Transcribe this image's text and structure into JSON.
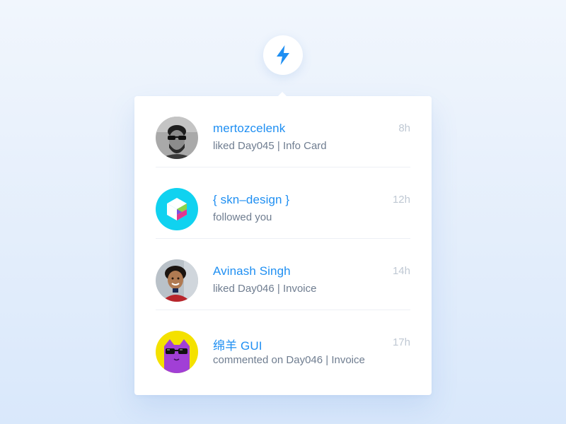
{
  "trigger": {
    "icon": "lightning-bolt-icon",
    "accent_color": "#1f8ff2"
  },
  "notifications": [
    {
      "name": "mertozcelenk",
      "action": "liked Day045 | Info Card",
      "time": "8h",
      "avatar": "bearded-man-sunglasses-avatar"
    },
    {
      "name": "{ skn–design }",
      "action": "followed you",
      "time": "12h",
      "avatar": "cube-logo-avatar"
    },
    {
      "name": "Avinash Singh",
      "action": "liked Day046 | Invoice",
      "time": "14h",
      "avatar": "smiling-man-avatar"
    },
    {
      "name": "绵羊 GUI",
      "action": "commented on Day046 | Invoice",
      "time": "17h",
      "avatar": "purple-cat-sunglasses-avatar"
    }
  ],
  "colors": {
    "name": "#1f8ff2",
    "action": "#6f7d90",
    "time": "#bfc8d3",
    "divider": "#edf0f5",
    "panel": "#ffffff"
  }
}
